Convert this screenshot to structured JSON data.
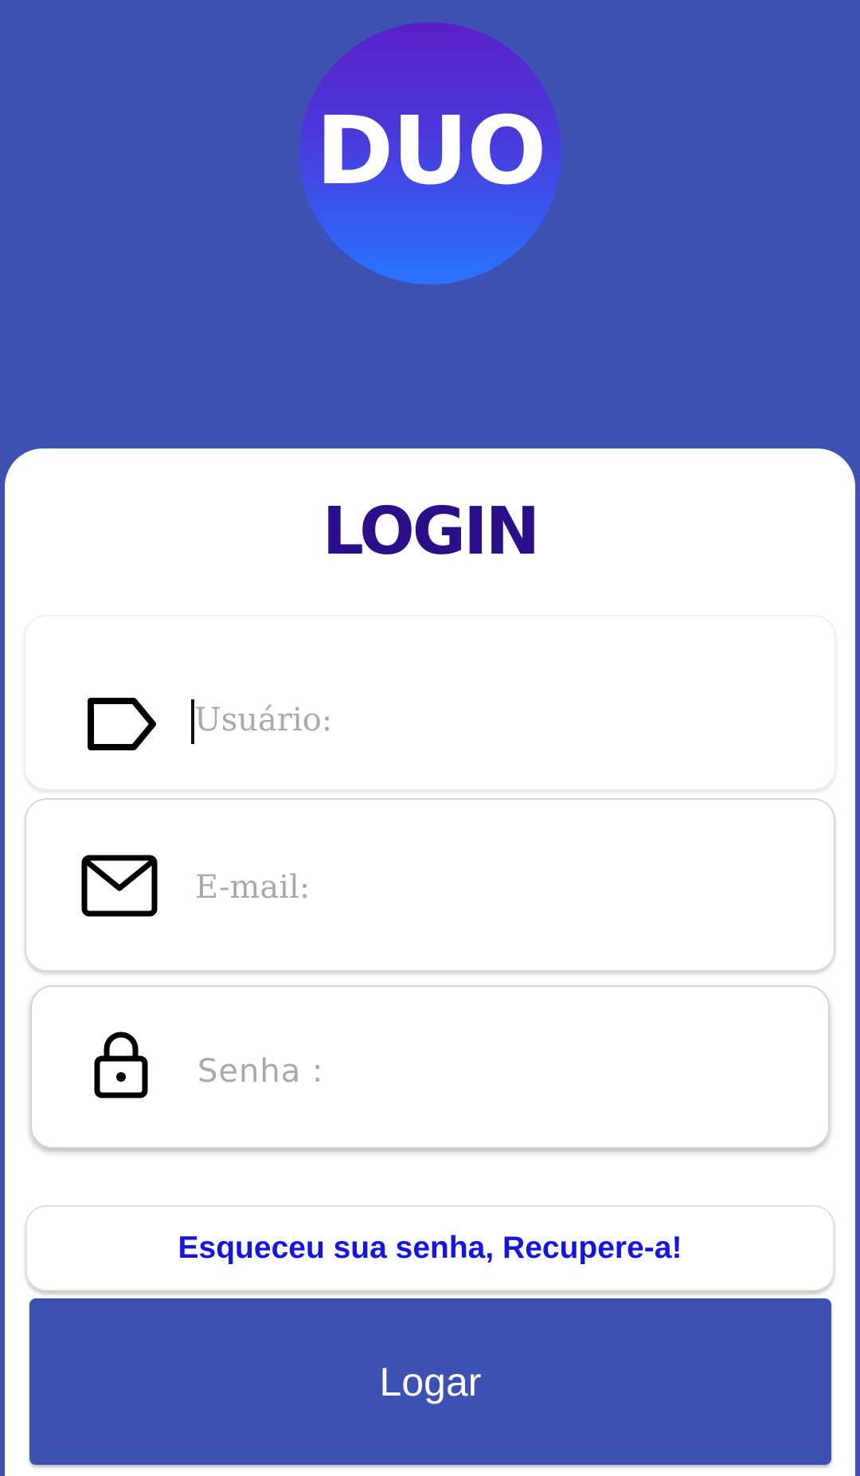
{
  "logo": {
    "text": "DUO"
  },
  "title": "LOGIN",
  "fields": {
    "user": {
      "placeholder": "Usuário:",
      "value": "",
      "icon": "tag-icon"
    },
    "email": {
      "placeholder": "E-mail:",
      "value": "",
      "icon": "mail-icon"
    },
    "password": {
      "placeholder": "Senha :",
      "value": "",
      "icon": "lock-icon"
    }
  },
  "recover_label": "Esqueceu sua senha, Recupere-a!",
  "login_label": "Logar",
  "colors": {
    "background": "#3d51b2",
    "title": "#2b0f8a",
    "link": "#1515e0",
    "button": "#3d51b2"
  }
}
